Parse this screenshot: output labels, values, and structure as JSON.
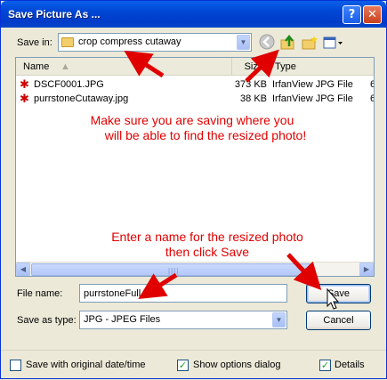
{
  "window": {
    "title": "Save Picture As ...",
    "help_glyph": "?",
    "close_glyph": "✕"
  },
  "save_in": {
    "label": "Save in:",
    "value": "crop compress cutaway"
  },
  "toolbar": {
    "icons": [
      "back-icon",
      "up-folder-icon",
      "new-folder-icon",
      "views-menu-icon"
    ]
  },
  "file_list": {
    "columns": [
      "Name",
      "Size",
      "Type"
    ],
    "rows": [
      {
        "name": "DSCF0001.JPG",
        "size": "373 KB",
        "type": "IrfanView JPG File",
        "extra": "6"
      },
      {
        "name": "purrstoneCutaway.jpg",
        "size": "38 KB",
        "type": "IrfanView JPG File",
        "extra": "6"
      }
    ]
  },
  "annotations": {
    "save_location": [
      "Make sure you are saving where you",
      "will be able to find the resized photo!"
    ],
    "enter_name": [
      "Enter a name for the resized photo",
      "then click Save"
    ],
    "color": "#e00000"
  },
  "file_name": {
    "label": "File name:",
    "value": "purrstoneFull"
  },
  "save_as_type": {
    "label": "Save as type:",
    "value": "JPG - JPEG Files"
  },
  "buttons": {
    "save": "Save",
    "cancel": "Cancel"
  },
  "options": {
    "save_date": {
      "label": "Save with original date/time",
      "checked": false
    },
    "show_options": {
      "label": "Show options dialog",
      "checked": true
    },
    "details": {
      "label": "Details",
      "checked": true
    }
  },
  "colors": {
    "titlebar": "#0046d5",
    "dialog_bg": "#ece9d8",
    "annotation": "#e00000"
  }
}
